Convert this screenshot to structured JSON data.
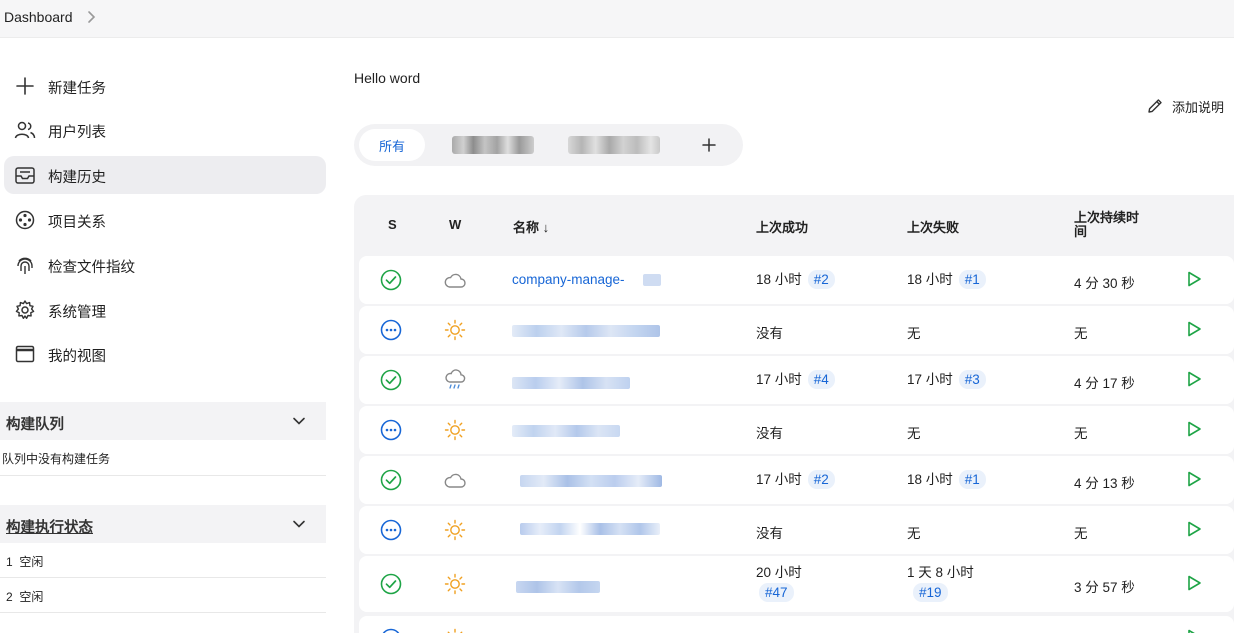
{
  "breadcrumb": {
    "home": "Dashboard"
  },
  "sidebar": {
    "items": [
      {
        "label": "新建任务",
        "icon": "plus-icon"
      },
      {
        "label": "用户列表",
        "icon": "users-icon"
      },
      {
        "label": "构建历史",
        "icon": "inbox-icon",
        "active": true
      },
      {
        "label": "项目关系",
        "icon": "relation-icon"
      },
      {
        "label": "检查文件指纹",
        "icon": "fingerprint-icon"
      },
      {
        "label": "系统管理",
        "icon": "gear-icon"
      },
      {
        "label": "我的视图",
        "icon": "window-icon"
      }
    ],
    "build_queue": {
      "title": "构建队列",
      "empty_text": "队列中没有构建任务"
    },
    "executors": {
      "title": "构建执行状态",
      "items": [
        {
          "id": "1",
          "status": "空闲"
        },
        {
          "id": "2",
          "status": "空闲"
        }
      ]
    }
  },
  "main": {
    "description": "Hello word",
    "add_description": "添加说明",
    "tabs": {
      "all": "所有"
    },
    "table": {
      "headers": {
        "s": "S",
        "w": "W",
        "name": "名称",
        "name_sort": "↓",
        "last_success": "上次成功",
        "last_failure": "上次失败",
        "last_duration": "上次持续时间"
      },
      "rows": [
        {
          "status": "success",
          "weather": "cloudy",
          "name": "company-manage-",
          "success_time": "18 小时",
          "success_build": "#2",
          "failure_time": "18 小时",
          "failure_build": "#1",
          "duration": "4 分 30 秒"
        },
        {
          "status": "notbuilt",
          "weather": "sunny",
          "name": "",
          "success_time": "没有",
          "success_build": "",
          "failure_time": "无",
          "failure_build": "",
          "duration": "无"
        },
        {
          "status": "success",
          "weather": "rainy",
          "name": "",
          "success_time": "17 小时",
          "success_build": "#4",
          "failure_time": "17 小时",
          "failure_build": "#3",
          "duration": "4 分 17 秒"
        },
        {
          "status": "notbuilt",
          "weather": "sunny",
          "name": "",
          "success_time": "没有",
          "success_build": "",
          "failure_time": "无",
          "failure_build": "",
          "duration": "无"
        },
        {
          "status": "success",
          "weather": "cloudy",
          "name": "",
          "success_time": "17 小时",
          "success_build": "#2",
          "failure_time": "18 小时",
          "failure_build": "#1",
          "duration": "4 分 13 秒"
        },
        {
          "status": "notbuilt",
          "weather": "sunny",
          "name": "",
          "success_time": "没有",
          "success_build": "",
          "failure_time": "无",
          "failure_build": "",
          "duration": "无"
        },
        {
          "status": "success",
          "weather": "sunny",
          "name": "",
          "success_time": "20 小时",
          "success_build": "#47",
          "failure_time": "1 天 8 小时",
          "failure_build": "#19",
          "duration": "3 分 57 秒"
        }
      ]
    }
  },
  "colors": {
    "accent": "#1766d6",
    "success": "#1ea446",
    "sun": "#f0a020",
    "cloud": "#888888"
  }
}
